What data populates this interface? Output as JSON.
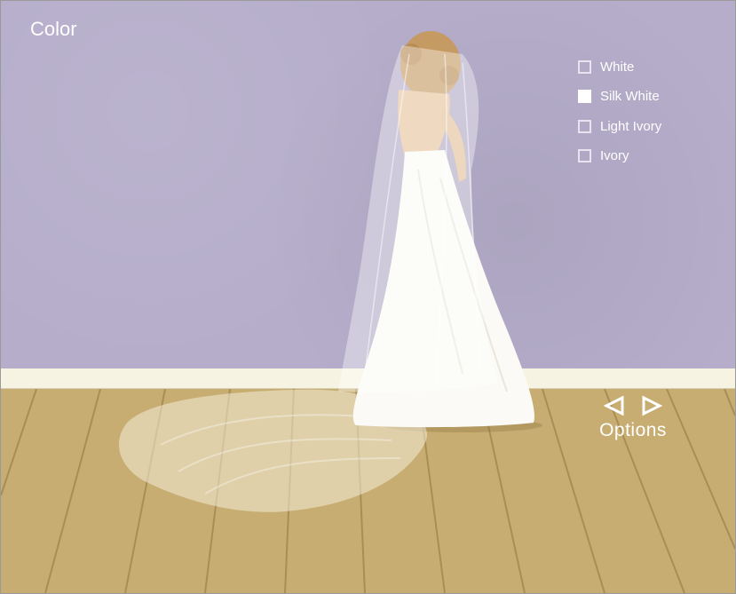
{
  "panel": {
    "title": "Color"
  },
  "colors": {
    "wall": "#b5adca",
    "baseboard": "#f7f3e3",
    "floor": "#c7ad72",
    "text": "#ffffff"
  },
  "color_options": [
    {
      "label": "White",
      "selected": false
    },
    {
      "label": "Silk White",
      "selected": true
    },
    {
      "label": "Light Ivory",
      "selected": false
    },
    {
      "label": "Ivory",
      "selected": false
    }
  ],
  "navigation": {
    "label": "Options",
    "prev_icon": "triangle-left-icon",
    "next_icon": "triangle-right-icon"
  }
}
